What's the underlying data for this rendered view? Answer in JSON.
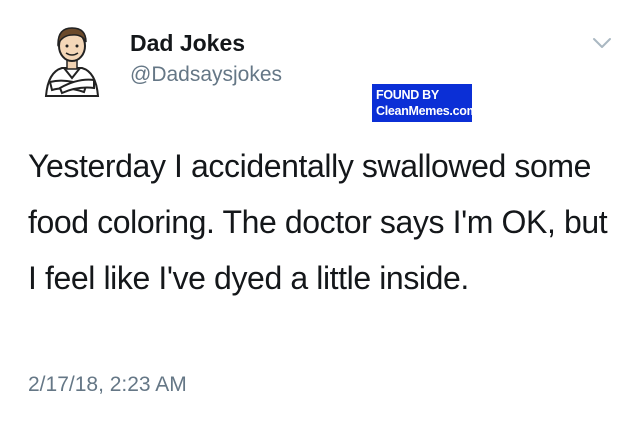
{
  "tweet": {
    "display_name": "Dad Jokes",
    "handle": "@Dadsaysjokes",
    "text": "Yesterday I accidentally swallowed some food coloring. The doctor says I'm OK, but I feel like I've dyed a little inside.",
    "timestamp": "2/17/18, 2:23 AM"
  },
  "watermark": {
    "line1": "FOUND BY",
    "line2": "CleanMemes.com",
    "background_color": "#0b2fd6"
  },
  "icons": {
    "avatar": "cartoon-man-arms-crossed-avatar",
    "menu": "chevron-down-icon"
  },
  "colors": {
    "text": "#14171a",
    "secondary": "#657786"
  }
}
